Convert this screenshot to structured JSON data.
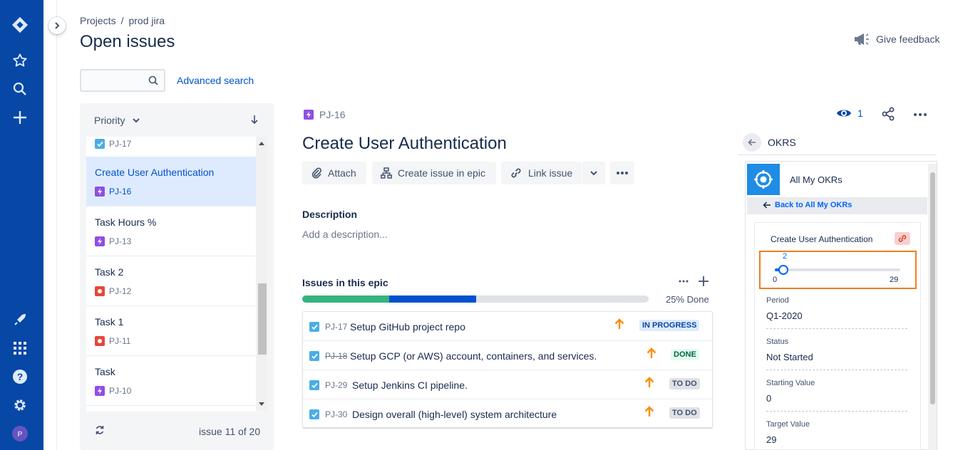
{
  "breadcrumb": {
    "projects": "Projects",
    "separator": "/",
    "project": "prod jira"
  },
  "page_title": "Open issues",
  "feedback_label": "Give feedback",
  "search": {
    "placeholder": ""
  },
  "advanced_search": "Advanced search",
  "list": {
    "sort_label": "Priority",
    "items": [
      {
        "title": "",
        "key": "PJ-17",
        "type": "task"
      },
      {
        "title": "Create User Authentication",
        "key": "PJ-16",
        "type": "epic",
        "selected": true
      },
      {
        "title": "Task Hours %",
        "key": "PJ-13",
        "type": "epic"
      },
      {
        "title": "Task 2",
        "key": "PJ-12",
        "type": "bug"
      },
      {
        "title": "Task 1",
        "key": "PJ-11",
        "type": "bug"
      },
      {
        "title": "Task",
        "key": "PJ-10",
        "type": "epic"
      }
    ],
    "pager": "issue 11 of 20"
  },
  "issue": {
    "key": "PJ-16",
    "watchers": "1",
    "title": "Create User Authentication",
    "actions": {
      "attach": "Attach",
      "create_in_epic": "Create issue in epic",
      "link": "Link issue"
    },
    "description_heading": "Description",
    "description_placeholder": "Add a description...",
    "epic": {
      "heading": "Issues in this epic",
      "progress": {
        "done_fraction": 0.25,
        "in_progress_fraction": 0.25
      },
      "progress_label": "25% Done",
      "rows": [
        {
          "key": "PJ-17",
          "summary": "Setup GitHub project repo",
          "status": "IN PROGRESS",
          "struck": false
        },
        {
          "key": "PJ-18",
          "summary": "Setup GCP (or AWS) account, containers, and services.",
          "status": "DONE",
          "struck": true
        },
        {
          "key": "PJ-29",
          "summary": "Setup Jenkins CI pipeline.",
          "status": "TO DO",
          "struck": false
        },
        {
          "key": "PJ-30",
          "summary": "Design overall (high-level) system architecture",
          "status": "TO DO",
          "struck": false
        }
      ]
    }
  },
  "okr": {
    "panel_title": "OKRS",
    "app_title": "All My OKRs",
    "back_link": "Back to All My OKRs",
    "card_title": "Create User Authentication",
    "slider": {
      "value": "2",
      "min": "0",
      "max": "29",
      "fraction": 0.069
    },
    "fields": [
      {
        "label": "Period",
        "value": "Q1-2020"
      },
      {
        "label": "Status",
        "value": "Not Started"
      },
      {
        "label": "Starting Value",
        "value": "0"
      },
      {
        "label": "Target Value",
        "value": "29"
      }
    ]
  },
  "colors": {
    "nav": "#0747a6",
    "link": "#0052cc",
    "priority_arrow": "#ff8b00",
    "highlight_box": "#ee7d22",
    "okr_blue": "#1f8ce6"
  },
  "icons": [
    "jira-logo-icon",
    "star-icon",
    "search-icon",
    "plus-icon",
    "rocket-icon",
    "apps-grid-icon",
    "help-icon",
    "gear-icon",
    "avatar"
  ]
}
